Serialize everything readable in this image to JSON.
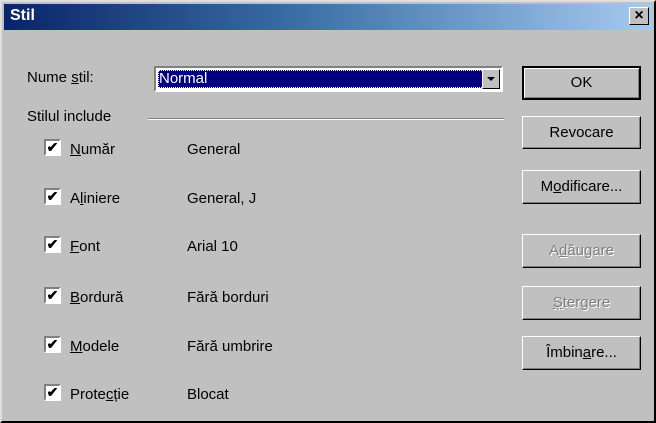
{
  "window": {
    "title": "Stil",
    "close_label": "×"
  },
  "style_name": {
    "label_pre": "Nume ",
    "label_ul": "s",
    "label_post": "til:",
    "value": "Normal"
  },
  "group_label": "Stilul include",
  "items": [
    {
      "ul": "N",
      "rest": "umăr",
      "value": "General",
      "checked": true
    },
    {
      "pre": "A",
      "ul": "l",
      "rest": "iniere",
      "value": "General, J",
      "checked": true
    },
    {
      "ul": "F",
      "rest": "ont",
      "value": "Arial 10",
      "checked": true
    },
    {
      "ul": "B",
      "rest": "ordură",
      "value": "Fără borduri",
      "checked": true
    },
    {
      "ul": "M",
      "rest": "odele",
      "value": "Fără umbrire",
      "checked": true
    },
    {
      "pre": "Prote",
      "ul": "c",
      "rest": "ție",
      "value": "Blocat",
      "checked": true
    }
  ],
  "check_mark": "✔",
  "buttons": {
    "ok": "OK",
    "cancel": "Revocare",
    "modify": {
      "pre": "M",
      "ul": "o",
      "post": "dificare..."
    },
    "add": {
      "pre": "A",
      "ul": "d",
      "post": "ăugare"
    },
    "delete": {
      "pre": "",
      "ul": "Ș",
      "post": "tergere"
    },
    "merge": {
      "pre": "Îmbin",
      "ul": "a",
      "post": "re..."
    }
  }
}
